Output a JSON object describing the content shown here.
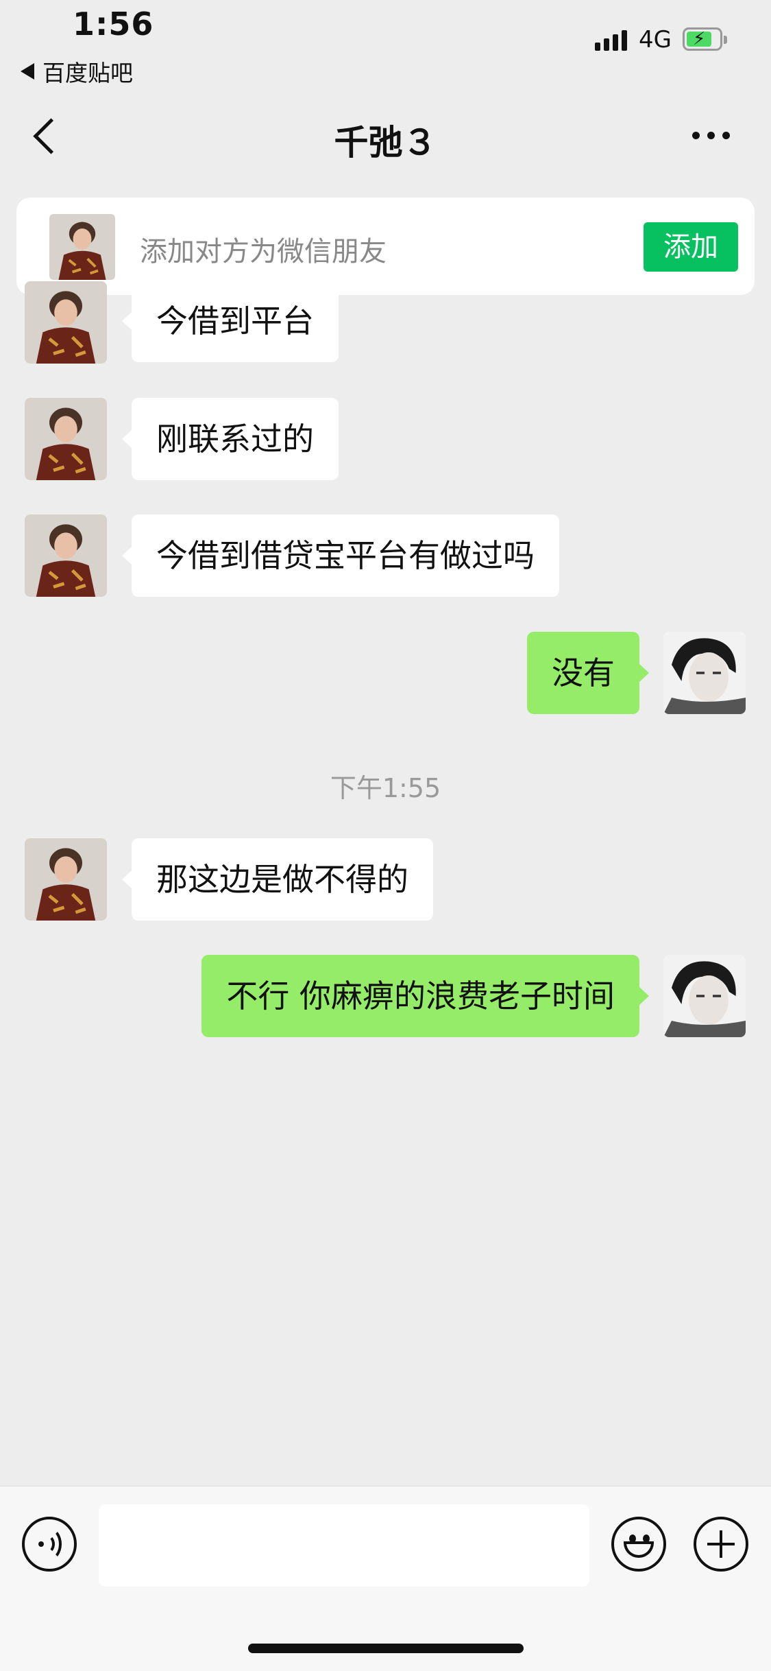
{
  "status_bar": {
    "time": "1:56",
    "back_app": "百度贴吧",
    "network": "4G"
  },
  "nav": {
    "title": "千弛３"
  },
  "banner": {
    "text": "添加对方为微信朋友",
    "button": "添加"
  },
  "messages": [
    {
      "side": "left",
      "text": "今借到平台"
    },
    {
      "side": "left",
      "text": "刚联系过的"
    },
    {
      "side": "left",
      "text": "今借到借贷宝平台有做过吗"
    },
    {
      "side": "right",
      "text": "没有"
    },
    {
      "side": "left",
      "text": "那这边是做不得的"
    },
    {
      "side": "right",
      "text": "不行 你麻痹的浪费老子时间"
    }
  ],
  "timestamp": "下午1:55",
  "colors": {
    "accent": "#07c160",
    "outgoing_bubble": "#95ec69",
    "incoming_bubble": "#ffffff",
    "background": "#ededed"
  }
}
